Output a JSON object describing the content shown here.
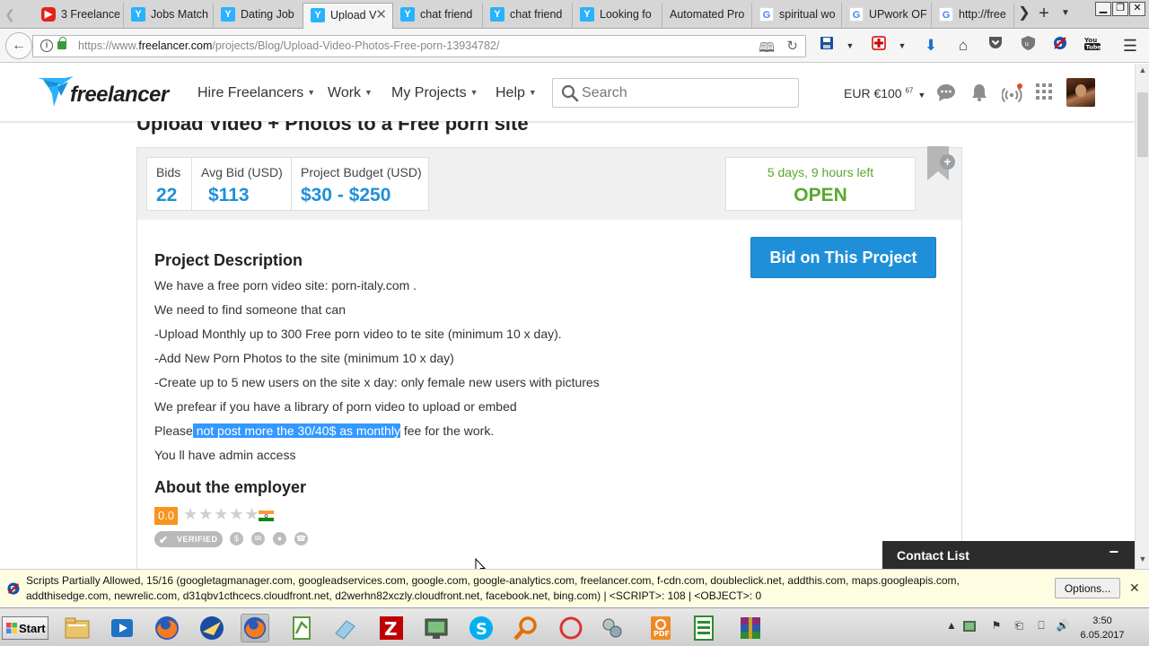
{
  "browser": {
    "tabs": [
      {
        "label": "3 Freelance",
        "icon": "youtube-icon",
        "active": false
      },
      {
        "label": "Jobs Match",
        "icon": "freelancer-icon",
        "active": false
      },
      {
        "label": "Dating Job",
        "icon": "freelancer-icon",
        "active": false
      },
      {
        "label": "Upload V",
        "icon": "freelancer-icon",
        "active": true
      },
      {
        "label": "chat friend",
        "icon": "freelancer-icon",
        "active": false
      },
      {
        "label": "chat friend",
        "icon": "freelancer-icon",
        "active": false
      },
      {
        "label": "Looking fo",
        "icon": "freelancer-icon",
        "active": false
      },
      {
        "label": "Automated Pro",
        "icon": "none",
        "active": false
      },
      {
        "label": "spiritual wo",
        "icon": "google-icon",
        "active": false
      },
      {
        "label": "UPwork OF",
        "icon": "google-icon",
        "active": false
      },
      {
        "label": "http://free",
        "icon": "google-icon",
        "active": false
      }
    ],
    "url_prefix": "https://www.",
    "url_host": "freelancer.com",
    "url_path": "/projects/Blog/Upload-Video-Photos-Free-porn-13934782/"
  },
  "header": {
    "logo_text": "freelancer",
    "menu": [
      "Hire Freelancers",
      "Work",
      "My Projects",
      "Help"
    ],
    "search_placeholder": "Search",
    "balance": "EUR €100",
    "balance_cents": "67"
  },
  "project": {
    "title": "Upload Video + Photos to a Free porn site",
    "stats": [
      {
        "label": "Bids",
        "value": "22"
      },
      {
        "label": "Avg Bid (USD)",
        "value": "$113"
      },
      {
        "label": "Project Budget (USD)",
        "value": "$30 - $250"
      }
    ],
    "time_left": "5 days, 9 hours left",
    "status": "OPEN",
    "bid_button": "Bid on This Project",
    "description_title": "Project Description",
    "description_lines": [
      "We have a free porn video site: porn-italy.com .",
      "We need to find someone that can",
      "-Upload Monthly up to 300 Free porn video to te site (minimum 10 x day).",
      "-Add New Porn Photos to the site (minimum 10 x day)",
      "-Create up to 5 new users on the site x day: only female new users with pictures",
      "We prefear if you have a library of porn video to upload or embed"
    ],
    "fee_line": {
      "before": "Please",
      "highlighted": " not post more the 30/40$ as monthly",
      "after": " fee for the work."
    },
    "last_line": "You ll have admin access",
    "employer_title": "About the employer",
    "rating": "0.0",
    "verified_label": "VERIFIED",
    "accent_color": "#1f8fd9",
    "status_color": "#5aa82e"
  },
  "contact_list": {
    "title": "Contact List",
    "minimize": "−"
  },
  "noscript": {
    "message": "Scripts Partially Allowed, 15/16 (googletagmanager.com, googleadservices.com, google.com, google-analytics.com, freelancer.com, f-cdn.com, doubleclick.net, addthis.com, maps.googleapis.com, addthisedge.com, newrelic.com, d31qbv1cthcecs.cloudfront.net, d2werhn82xczly.cloudfront.net, facebook.net, bing.com) | <SCRIPT>: 108 | <OBJECT>: 0",
    "options_label": "Options..."
  },
  "taskbar": {
    "start_label": "Start",
    "time": "3:50",
    "date": "6.05.2017"
  }
}
